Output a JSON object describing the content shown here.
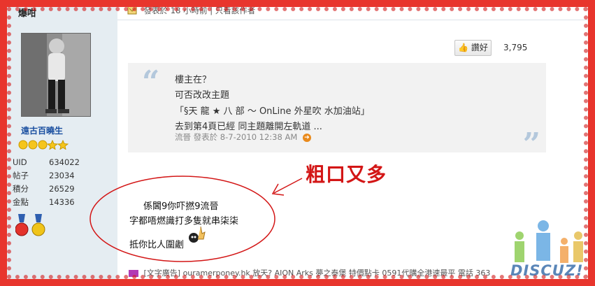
{
  "post": {
    "author": "爆咁",
    "header_text": "發表於 18 小時前 | 只看該作者",
    "like_label": "讚好",
    "like_count": "3,795"
  },
  "profile": {
    "rank": "遠古百曉生",
    "stats": [
      {
        "key": "UID",
        "value": "634022"
      },
      {
        "key": "帖子",
        "value": "23034"
      },
      {
        "key": "積分",
        "value": "26529"
      },
      {
        "key": "金點",
        "value": "14336"
      }
    ]
  },
  "quote": {
    "lines": [
      "樓主在？",
      "可否改改主題",
      "「§天 龍 ★ 八 部 ～ OnLine 外星吹 水加油站」",
      "去到第4頁已經 同主題離開左軌道 ..."
    ],
    "meta": "流晉 發表於 8-7-2010 12:38 AM"
  },
  "annotation": {
    "label": "粗口又多"
  },
  "body": {
    "lines": [
      "係閪9你吓撚9流晉",
      "字都唔燃識打多隻就串柒柒",
      "抵你比人圍劌"
    ]
  },
  "signature": {
    "text": "[文字廣告] ouramerponey.hk 放天? AION Arks 夢之泰堡 特價點卡 0591代購全港速最平 電話 363"
  },
  "watermark": {
    "text": "DISCUZ!"
  },
  "colors": {
    "frame": "#e8352d",
    "annotation": "#d31616",
    "sidebar": "#e5edf2",
    "quote_bg": "#f2f2f2",
    "link": "#1a4fa0"
  }
}
